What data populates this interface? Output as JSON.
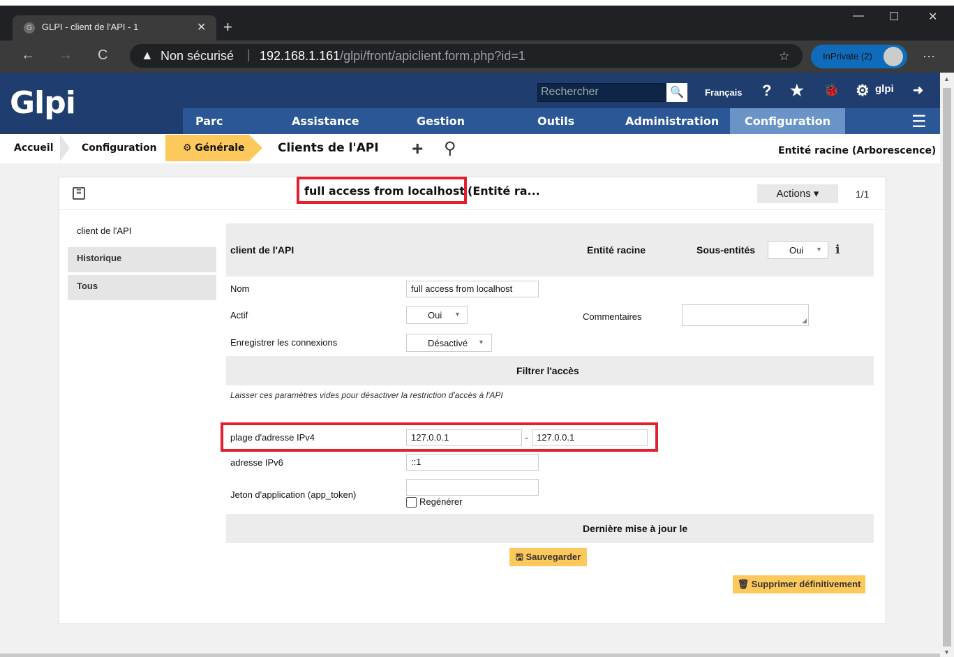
{
  "browser": {
    "tab_title": "GLPI - client de l'API - 1",
    "tab_favicon": "G",
    "close_glyph": "✕",
    "new_tab_glyph": "+",
    "back_glyph": "←",
    "forward_glyph": "→",
    "reload_glyph": "C",
    "warning_glyph": "▲",
    "security_text": "Non sécurisé",
    "url_host": "192.168.1.161",
    "url_path": "/glpi/front/apiclient.form.php?id=1",
    "favorites_glyph": "☆",
    "inprivate_label": "InPrivate (2)",
    "more_glyph": "···",
    "minimize_glyph": "—",
    "maximize_glyph": "☐",
    "window_close_glyph": "✕"
  },
  "glpi": {
    "logo": "Glpi",
    "search_placeholder": "Rechercher",
    "search_glyph": "🔍",
    "language": "Français",
    "help_glyph": "?",
    "star_glyph": "★",
    "bug_glyph": "🐞",
    "gear_glyph": "⚙",
    "user": "glpi",
    "logout_glyph": "➜",
    "menu": [
      "Parc",
      "Assistance",
      "Gestion",
      "Outils",
      "Administration",
      "Configuration"
    ],
    "hamburger_glyph": "☰"
  },
  "breadcrumb": {
    "home": "Accueil",
    "config": "Configuration",
    "general": "⚙ Générale",
    "title": "Clients de l'API",
    "add_glyph": "+",
    "search_glyph": "⚲",
    "entity": "Entité racine (Arborescence)"
  },
  "item": {
    "list_glyph": "≣",
    "title": "full access from localhost",
    "title_rest": "(Entité ra...",
    "actions_label": "Actions ▾",
    "pager": "1/1"
  },
  "tabs": {
    "main": "client de l'API",
    "history": "Historique",
    "all": "Tous"
  },
  "form": {
    "header_label": "client de l'API",
    "entity_label": "Entité racine",
    "subentities_label": "Sous-entités",
    "subentities_value": "Oui",
    "info_glyph": "i",
    "name_label": "Nom",
    "name_value": "full access from localhost",
    "active_label": "Actif",
    "active_value": "Oui",
    "comments_label": "Commentaires",
    "log_label": "Enregistrer les connexions",
    "log_value": "Désactivé",
    "filter_header": "Filtrer l'accès",
    "filter_hint": "Laisser ces paramètres vides pour désactiver la restriction d'accès à l'API",
    "ipv4_label": "plage d'adresse IPv4",
    "ipv4_start": "127.0.0.1",
    "ipv4_sep": "-",
    "ipv4_end": "127.0.0.1",
    "ipv6_label": "adresse IPv6",
    "ipv6_value": "::1",
    "token_label": "Jeton d'application (app_token)",
    "token_value": "",
    "regen_label": "Regénérer",
    "last_update_label": "Dernière mise à jour le",
    "save_label": "🖫 Sauvegarder",
    "delete_label": "🗑 Supprimer définitivement",
    "caret_glyph": "▼",
    "grip_glyph": "◢"
  }
}
